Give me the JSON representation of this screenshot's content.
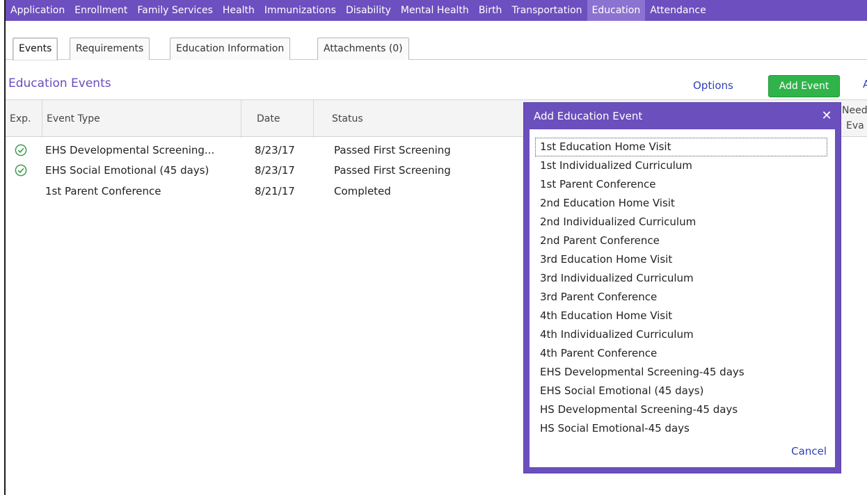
{
  "topnav": {
    "items": [
      {
        "label": "Application"
      },
      {
        "label": "Enrollment"
      },
      {
        "label": "Family Services"
      },
      {
        "label": "Health"
      },
      {
        "label": "Immunizations"
      },
      {
        "label": "Disability"
      },
      {
        "label": "Mental Health"
      },
      {
        "label": "Birth"
      },
      {
        "label": "Transportation"
      },
      {
        "label": "Education",
        "active": true
      },
      {
        "label": "Attendance"
      }
    ]
  },
  "subtabs": [
    {
      "label": "Events",
      "active": true
    },
    {
      "label": "Requirements"
    },
    {
      "label": "Education Information"
    },
    {
      "label": "Attachments (0)"
    }
  ],
  "section": {
    "title": "Education Events",
    "options_label": "Options",
    "add_event_label": "Add Event"
  },
  "table": {
    "headers": {
      "exp": "Exp.",
      "event_type": "Event Type",
      "date": "Date",
      "status": "Status",
      "need_line1": "Need",
      "need_line2": "Eva"
    },
    "rows": [
      {
        "exp": "check",
        "event_type": "EHS Developmental Screening...",
        "date": "8/23/17",
        "status": "Passed First Screening"
      },
      {
        "exp": "check",
        "event_type": "EHS Social Emotional (45 days)",
        "date": "8/23/17",
        "status": "Passed First Screening"
      },
      {
        "exp": "",
        "event_type": "1st Parent Conference",
        "date": "8/21/17",
        "status": "Completed"
      }
    ]
  },
  "modal": {
    "title": "Add Education Event",
    "close_icon": "close-icon",
    "options": [
      "1st Education Home Visit",
      "1st Individualized Curriculum",
      "1st Parent Conference",
      "2nd Education Home Visit",
      "2nd Individualized Curriculum",
      "2nd Parent Conference",
      "3rd Education Home Visit",
      "3rd Individualized Curriculum",
      "3rd Parent Conference",
      "4th Education Home Visit",
      "4th Individualized Curriculum",
      "4th Parent Conference",
      "EHS Developmental Screening-45 days",
      "EHS Social Emotional (45 days)",
      "HS Developmental Screening-45 days",
      "HS Social Emotional-45 days"
    ],
    "focused_index": 0,
    "cancel_label": "Cancel"
  },
  "colors": {
    "nav_purple": "#6d4fbf",
    "title_purple": "#6a4cbf",
    "add_green": "#2fb44a",
    "link_blue": "#2e3fb8",
    "check_green": "#3a9a4a"
  }
}
